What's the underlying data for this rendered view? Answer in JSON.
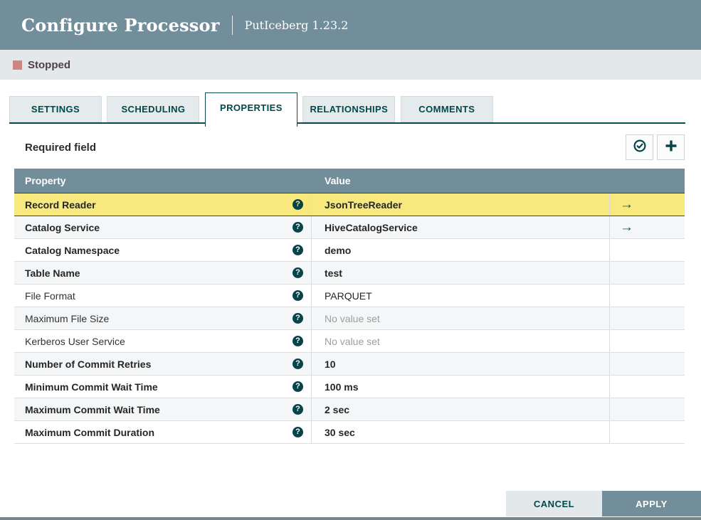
{
  "dialog": {
    "title": "Configure Processor",
    "subtitle": "PutIceberg 1.23.2"
  },
  "status": {
    "label": "Stopped"
  },
  "tabs": [
    {
      "label": "SETTINGS",
      "active": false
    },
    {
      "label": "SCHEDULING",
      "active": false
    },
    {
      "label": "PROPERTIES",
      "active": true
    },
    {
      "label": "RELATIONSHIPS",
      "active": false
    },
    {
      "label": "COMMENTS",
      "active": false
    }
  ],
  "properties_panel": {
    "required_label": "Required field",
    "actions": [
      {
        "name": "verify-properties",
        "icon": "check-circle-icon"
      },
      {
        "name": "add-property",
        "icon": "plus-icon"
      }
    ]
  },
  "table": {
    "columns": {
      "property": "Property",
      "value": "Value"
    },
    "rows": [
      {
        "property": "Record Reader",
        "value": "JsonTreeReader",
        "required": true,
        "selected": true,
        "empty": false,
        "link": true
      },
      {
        "property": "Catalog Service",
        "value": "HiveCatalogService",
        "required": true,
        "selected": false,
        "empty": false,
        "link": true
      },
      {
        "property": "Catalog Namespace",
        "value": "demo",
        "required": true,
        "selected": false,
        "empty": false,
        "link": false
      },
      {
        "property": "Table Name",
        "value": "test",
        "required": true,
        "selected": false,
        "empty": false,
        "link": false
      },
      {
        "property": "File Format",
        "value": "PARQUET",
        "required": false,
        "selected": false,
        "empty": false,
        "link": false
      },
      {
        "property": "Maximum File Size",
        "value": "No value set",
        "required": false,
        "selected": false,
        "empty": true,
        "link": false
      },
      {
        "property": "Kerberos User Service",
        "value": "No value set",
        "required": false,
        "selected": false,
        "empty": true,
        "link": false
      },
      {
        "property": "Number of Commit Retries",
        "value": "10",
        "required": true,
        "selected": false,
        "empty": false,
        "link": false
      },
      {
        "property": "Minimum Commit Wait Time",
        "value": "100 ms",
        "required": true,
        "selected": false,
        "empty": false,
        "link": false
      },
      {
        "property": "Maximum Commit Wait Time",
        "value": "2 sec",
        "required": true,
        "selected": false,
        "empty": false,
        "link": false
      },
      {
        "property": "Maximum Commit Duration",
        "value": "30 sec",
        "required": true,
        "selected": false,
        "empty": false,
        "link": false
      }
    ]
  },
  "footer": {
    "cancel_label": "CANCEL",
    "apply_label": "APPLY"
  },
  "colors": {
    "header_bg": "#728e9b",
    "accent_teal": "#07434a",
    "tab_text": "#004849",
    "status_stopped_square": "#d08484",
    "selected_row_bg": "#f7e97e",
    "row_alt_bg": "#f4f6f7",
    "bar_bg": "#e3e8eb",
    "empty_value_text": "#9e9e9e"
  }
}
